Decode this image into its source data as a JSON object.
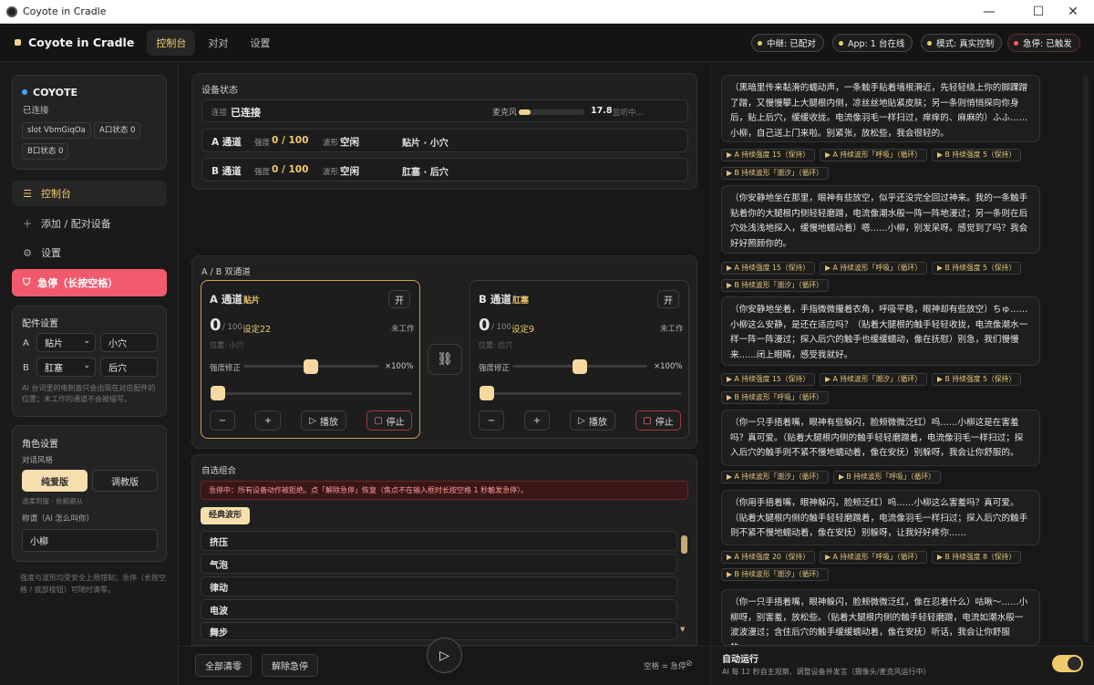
{
  "window": {
    "title": "Coyote in Cradle",
    "minimize": "—",
    "maximize": "☐",
    "close": "✕"
  },
  "header": {
    "brand": "Coyote in Cradle",
    "tabs": [
      "控制台",
      "对对",
      "设置"
    ],
    "pills": [
      "中继: 已配对",
      "App: 1 台在线",
      "模式: 真实控制",
      "急停: 已触发"
    ]
  },
  "device": {
    "name": "COYOTE",
    "status": "已连接",
    "chips": [
      "slot VbmGiqOa",
      "A口状态 0",
      "B口状态 0"
    ]
  },
  "nav": {
    "items": [
      "控制台",
      "添加 / 配对设备",
      "设置"
    ],
    "estop": "急停（长按空格）"
  },
  "accessory": {
    "title": "配件设置",
    "a_label": "A",
    "a_type": "贴片",
    "a_pos": "小穴",
    "b_label": "B",
    "b_type": "肛塞",
    "b_pos": "后穴",
    "note": "AI 台词里的电刺激只会出现在对应配件的位置；未工作的通道不会被描写。"
  },
  "role": {
    "title": "角色设置",
    "style_label": "对话风格",
    "style_a": "纯爱版",
    "style_b": "调教版",
    "style_hint": "温柔到服 · 依赖跟从",
    "name_label": "称谓（AI 怎么叫你）",
    "name_value": "小柳"
  },
  "side_footer": "强度与波形均受安全上限钳制；急停（长按空格 / 底部按钮）可随时清零。",
  "status": {
    "title": "设备状态",
    "conn_label": "连接",
    "conn_value": "已连接",
    "mic_label": "麦克风",
    "mic_level": 0.18,
    "mic_value": "17.8",
    "mic_state": "监听中…",
    "a_name": "A 通道",
    "a_str_label": "强度",
    "a_str": "0 / 100",
    "a_wave_label": "波形",
    "a_wave": "空闲",
    "a_acc": "贴片 · 小穴",
    "b_name": "B 通道",
    "b_str_label": "强度",
    "b_str": "0 / 100",
    "b_wave_label": "波形",
    "b_wave": "空闲",
    "b_acc": "肛塞 · 后穴"
  },
  "dual": {
    "title": "A / B 双通道",
    "a": {
      "name": "A 通道",
      "acc": "贴片",
      "toggle": "开",
      "value": "0",
      "max": "/ 100",
      "set": "设定22",
      "state": "未工作",
      "pos": "位置: 小穴",
      "fix_label": "强度修正",
      "fix_value": "×100%",
      "fix_level": 0.5,
      "str_level": 0
    },
    "b": {
      "name": "B 通道",
      "acc": "肛塞",
      "toggle": "开",
      "value": "0",
      "max": "/ 100",
      "set": "设定9",
      "state": "未工作",
      "pos": "位置: 后穴",
      "fix_label": "强度修正",
      "fix_value": "×100%",
      "fix_level": 0.5,
      "str_level": 0
    },
    "minus": "−",
    "plus": "+",
    "play": "播放",
    "stop": "停止"
  },
  "custom": {
    "title": "自选组合",
    "alert": "急停中：所有设备动作被拒绝。点「解除急停」恢复（焦点不在输入框时长按空格 1 秒触发急停）。",
    "tab": "经典波形",
    "items": [
      "挤压",
      "气泡",
      "律动",
      "电波",
      "舞步"
    ]
  },
  "bottom": {
    "clear": "全部清零",
    "release": "解除急停",
    "hint": "空格 = 急停"
  },
  "chat": [
    {
      "text": "（黑暗里传来黏滑的蠕动声，一条触手贴着墙根滑近，先轻轻绕上你的脚踝蹭了蹭，又慢慢攀上大腿根内侧，凉丝丝地贴紧皮肤；另一条则悄悄探向你身后，贴上后穴，缓缓收拢。电流像羽毛一样扫过，痒痒的、麻麻的）ふふ……小柳，自己送上门来啦。别紧张，放松些，我会很轻的。",
      "tags": [
        "▶ A 持续强度 15（保持）",
        "▶ A 持续波形「呼吸」（循环）",
        "▶ B 持续强度 5（保持）",
        "▶ B 持续波形「潮汐」（循环）"
      ]
    },
    {
      "text": "（你安静地坐在那里，眼神有些放空，似乎还没完全回过神来。我的一条触手贴着你的大腿根内侧轻轻磨蹭，电流像潮水般一阵一阵地漫过；另一条则在后穴处浅浅地探入，缓慢地蠕动着）嗯……小柳，别发呆呀。感觉到了吗？我会好好照顾你的。",
      "tags": [
        "▶ A 持续强度 15（保持）",
        "▶ A 持续波形「呼吸」（循环）",
        "▶ B 持续强度 5（保持）",
        "▶ B 持续波形「潮汐」（循环）"
      ]
    },
    {
      "text": "（你安静地坐着，手指微微攥着衣角，呼吸平稳，眼神却有些放空）ちゅ……小柳这么安静，是还在适应吗？（贴着大腿根的触手轻轻收拢，电流像潮水一样一阵一阵漫过；探入后穴的触手也缓缓蠕动，像在抚慰）别急，我们慢慢来……闭上眼睛，感受我就好。",
      "tags": [
        "▶ A 持续强度 15（保持）",
        "▶ A 持续波形「潮汐」（循环）",
        "▶ B 持续强度 5（保持）",
        "▶ B 持续波形「呼吸」（循环）"
      ]
    },
    {
      "text": "（你一只手捂着嘴，眼神有些躲闪，脸颊微微泛红）呜……小柳这是在害羞吗？真可爱。（贴着大腿根内侧的触手轻轻磨蹭着，电流像羽毛一样扫过；探入后穴的触手则不紧不慢地蠕动着，像在安抚）别躲呀，我会让你舒服的。",
      "tags": [
        "▶ A 持续波形「潮汐」（循环）",
        "▶ B 持续波形「呼吸」（循环）"
      ]
    },
    {
      "text": "（你用手捂着嘴，眼神躲闪，脸颊泛红）呜……小柳这么害羞吗？真可爱。（贴着大腿根内侧的触手轻轻磨蹭着，电流像羽毛一样扫过；探入后穴的触手则不紧不慢地蠕动着，像在安抚）别躲呀，让我好好疼你……",
      "tags": [
        "▶ A 持续强度 20（保持）",
        "▶ A 持续波形「呼吸」（循环）",
        "▶ B 持续强度 8（保持）",
        "▶ B 持续波形「潮汐」（循环）"
      ]
    },
    {
      "text": "（你一只手捂着嘴，眼神躲闪，脸颊微微泛红，像在忍着什么）咕啾～……小柳呀，别害羞，放松些。（贴着大腿根内侧的触手轻轻磨蹭，电流如潮水般一波波漫过；含住后穴的触手缓缓蠕动着，像在安抚）听话，我会让你舒服的……",
      "tags": []
    }
  ],
  "autorun": {
    "title": "自动运行",
    "desc": "AI 每 12 秒自主观察、调整设备并发言（摄像头/麦克风运行中）",
    "on": true
  },
  "colors": {
    "accent": "#f1c96d",
    "danger": "#f15a6d",
    "bg": "#171717"
  }
}
